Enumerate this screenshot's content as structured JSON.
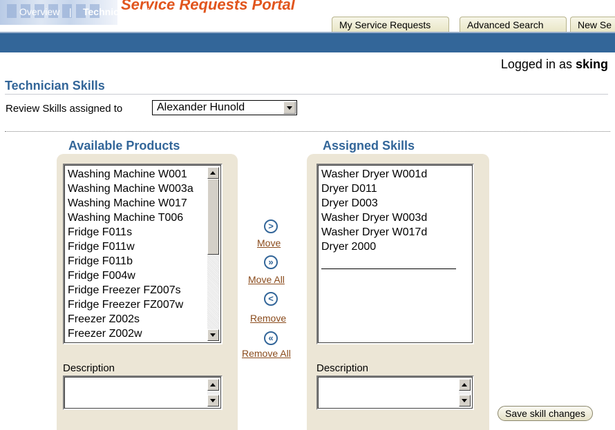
{
  "header": {
    "app_title": "Service Requests Portal",
    "tabs": [
      {
        "label": "My Service Requests"
      },
      {
        "label": "Advanced Search"
      },
      {
        "label": "New Se"
      }
    ]
  },
  "nav": {
    "overview": "Overview",
    "separator": "|",
    "current": "Technician Skills"
  },
  "user": {
    "prefix": "Logged in as",
    "name": "sking"
  },
  "page": {
    "title": "Technician Skills",
    "review_label": "Review Skills assigned to",
    "review_selected": "Alexander Hunold"
  },
  "available": {
    "heading": "Available Products",
    "items": [
      "Washing Machine W001",
      "Washing Machine W003a",
      "Washing Machine W017",
      "Washing Machine T006",
      "Fridge F011s",
      "Fridge F011w",
      "Fridge F011b",
      "Fridge F004w",
      "Fridge Freezer FZ007s",
      "Fridge Freezer FZ007w",
      "Freezer Z002s",
      "Freezer Z002w"
    ],
    "description_label": "Description",
    "description_value": ""
  },
  "assigned": {
    "heading": "Assigned Skills",
    "items": [
      "Washer Dryer W001d",
      "Dryer D011",
      "Dryer D003",
      "Washer Dryer W003d",
      "Washer Dryer W017d",
      "Dryer 2000"
    ],
    "description_label": "Description",
    "description_value": ""
  },
  "shuttle": {
    "move": {
      "icon": "move-right-icon",
      "glyph": ">",
      "label": "Move"
    },
    "move_all": {
      "icon": "move-all-right-icon",
      "glyph": "»",
      "label": "Move All"
    },
    "remove": {
      "icon": "move-left-icon",
      "glyph": "<",
      "label": "Remove"
    },
    "remove_all": {
      "icon": "move-all-left-icon",
      "glyph": "«",
      "label": "Remove All"
    }
  },
  "actions": {
    "save_label": "Save skill changes"
  },
  "colors": {
    "brand_blue": "#336699",
    "title_orange": "#e1551d",
    "panel_beige": "#ece6d6",
    "link_brown": "#8a4b1c"
  }
}
